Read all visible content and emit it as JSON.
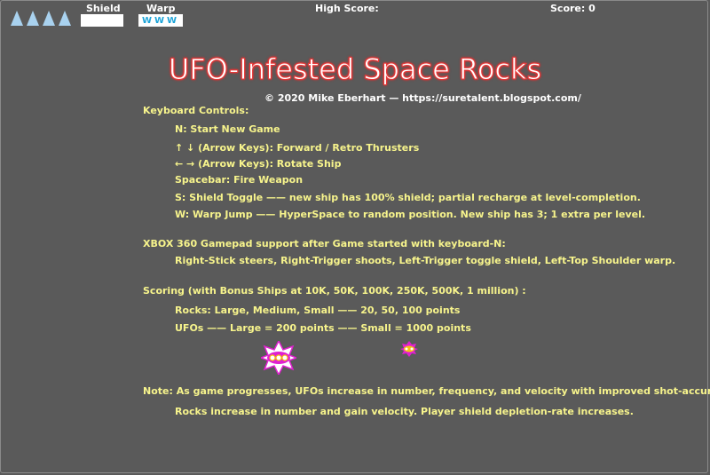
{
  "hud": {
    "lives": 4,
    "shield_label": "Shield",
    "warp_label": "Warp",
    "warp_value": "WWW",
    "shield_level": 1.0,
    "high_score_label": "High Score:",
    "score_label": "Score: 0"
  },
  "title": "UFO-Infested Space Rocks",
  "copyright": "© 2020 Mike Eberhart — https://suretalent.blogspot.com/",
  "keyboard": {
    "heading": "Keyboard Controls:",
    "lines": [
      "N: Start New Game",
      "↑  ↓  (Arrow Keys): Forward / Retro Thrusters",
      "← → (Arrow Keys): Rotate Ship",
      "Spacebar: Fire Weapon",
      "S:  Shield Toggle —— new ship has 100% shield; partial recharge at level-completion.",
      "W: Warp Jump    —— HyperSpace to random position. New ship has 3; 1 extra per level."
    ]
  },
  "gamepad": {
    "heading": "XBOX 360 Gamepad support after Game started with keyboard-N:",
    "line": "Right-Stick steers, Right-Trigger shoots, Left-Trigger toggle shield, Left-Top Shoulder warp."
  },
  "scoring": {
    "heading": "Scoring (with Bonus Ships at 10K, 50K, 100K, 250K, 500K, 1 million) :",
    "rocks": "Rocks: Large, Medium, Small —— 20, 50, 100 points",
    "ufos": "UFOs ——   Large = 200 points   ——    Small = 1000 points"
  },
  "note": {
    "line1": "Note:  As game progresses, UFOs increase in number, frequency, and velocity with improved shot-accuracy;",
    "line2": "Rocks  increase in number and gain velocity.  Player shield depletion-rate increases."
  },
  "colors": {
    "background": "#5a5a5a",
    "text": "#f7f48c",
    "title_glow": "#ff3030",
    "ufo_magenta": "#e020d0",
    "ufo_yellow": "#f5c010"
  }
}
